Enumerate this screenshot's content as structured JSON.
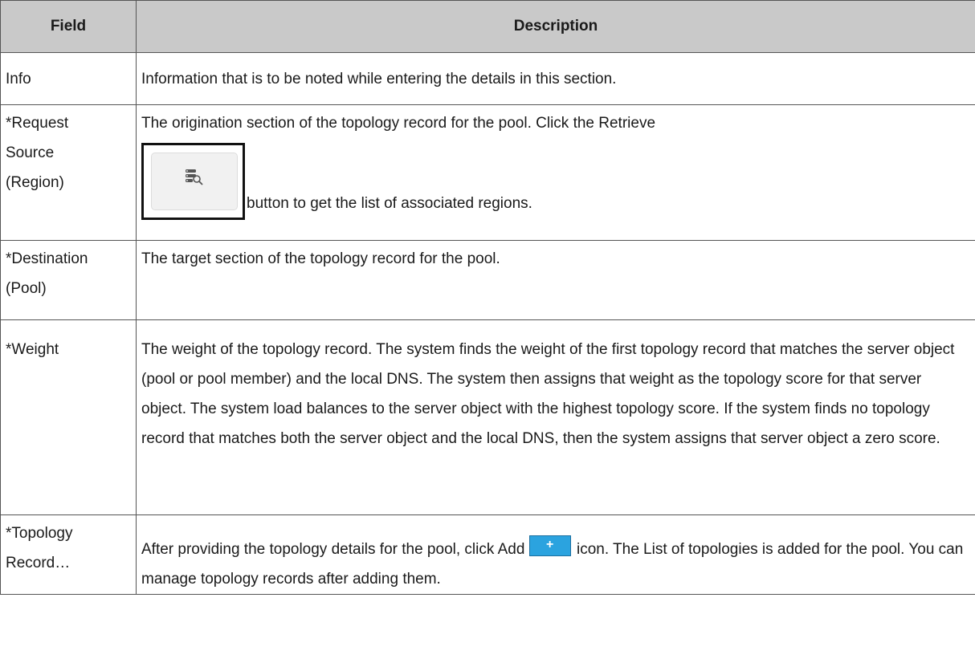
{
  "table": {
    "headers": {
      "field": "Field",
      "description": "Description"
    },
    "rows": [
      {
        "field": "Info",
        "description": "Information that is to be noted while entering the details in this section."
      },
      {
        "field_lines": [
          "*Request",
          "Source",
          "(Region)"
        ],
        "description_before": "The origination section of the topology record for the pool. Click the Retrieve",
        "button_icon": "retrieve-list-search-icon",
        "description_after": "button to get the list of associated regions."
      },
      {
        "field_lines": [
          "*Destination",
          "(Pool)"
        ],
        "description": "The target section of the topology record for the pool."
      },
      {
        "field": "*Weight",
        "description": "The weight of the topology record. The system finds the weight of the first topology record that matches the server object (pool or pool member) and the local DNS. The system then assigns that weight as the topology score for that server object. The system load balances to the server object with the highest topology score. If the system finds no topology record that matches both the server object and the local DNS, then the system assigns that server object a zero score."
      },
      {
        "field_lines": [
          "*Topology",
          "Record…"
        ],
        "description_before": "After providing the topology details for the pool, click Add",
        "add_icon_glyph": "+",
        "description_after": "icon. The List of topologies is added for the pool. You can manage topology records after adding them."
      }
    ]
  },
  "colors": {
    "header_bg": "#c9c9c9",
    "border": "#555555",
    "add_icon_bg": "#2ba3df"
  }
}
